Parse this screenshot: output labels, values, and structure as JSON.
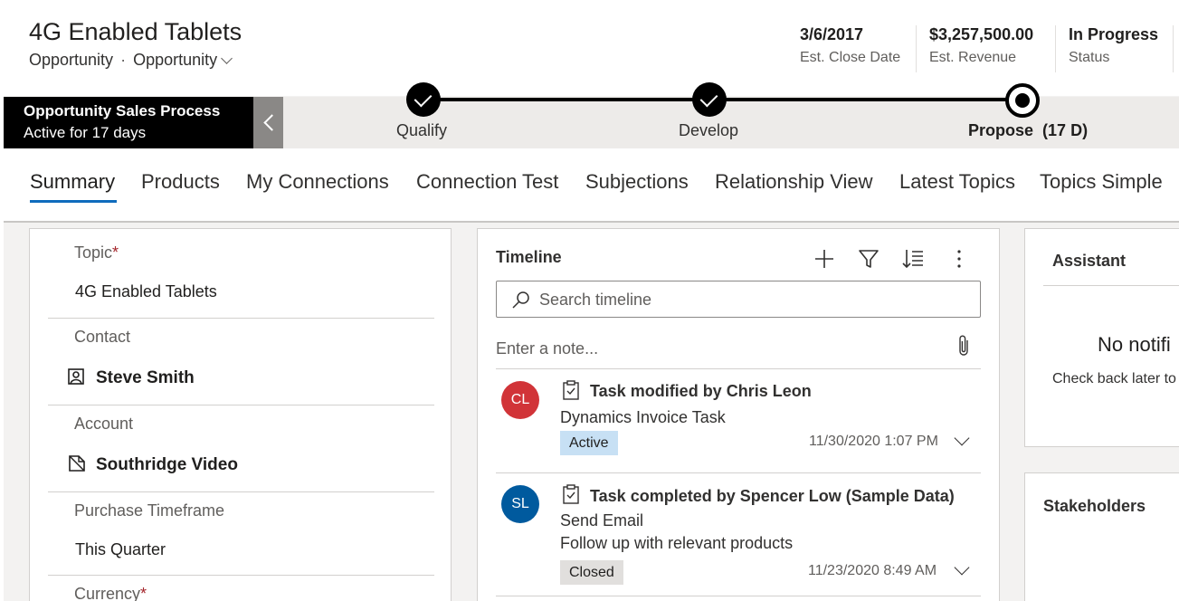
{
  "header": {
    "title": "4G Enabled Tablets",
    "entity": "Opportunity",
    "separator": "·",
    "form": "Opportunity",
    "fields": [
      {
        "value": "3/6/2017",
        "label": "Est. Close Date"
      },
      {
        "value": "$3,257,500.00",
        "label": "Est. Revenue"
      },
      {
        "value": "In Progress",
        "label": "Status"
      }
    ]
  },
  "bpf": {
    "name": "Opportunity Sales Process",
    "duration": "Active for 17 days",
    "stages": [
      {
        "label": "Qualify",
        "state": "completed"
      },
      {
        "label": "Develop",
        "state": "completed"
      },
      {
        "label": "Propose",
        "duration": "(17 D)",
        "state": "active"
      }
    ]
  },
  "tabs": [
    "Summary",
    "Products",
    "My Connections",
    "Connection Test",
    "Subjections",
    "Relationship View",
    "Latest Topics",
    "Topics Simple"
  ],
  "selected_tab": "Summary",
  "form": {
    "fields": [
      {
        "label": "Topic",
        "required": "*",
        "value": "4G Enabled Tablets"
      },
      {
        "label": "Contact",
        "value": "Steve Smith",
        "icon": "contact-icon"
      },
      {
        "label": "Account",
        "value": "Southridge Video",
        "icon": "account-icon"
      },
      {
        "label": "Purchase Timeframe",
        "value": "This Quarter"
      },
      {
        "label": "Currency",
        "required": "*"
      }
    ]
  },
  "timeline": {
    "title": "Timeline",
    "search_placeholder": "Search timeline",
    "note_placeholder": "Enter a note...",
    "activities": [
      {
        "initials": "CL",
        "avatar_color": "#d13438",
        "title": "Task modified by Chris Leon",
        "lines": [
          "Dynamics Invoice Task"
        ],
        "status": "Active",
        "status_color": "#c7e0f4",
        "time": "11/30/2020 1:07 PM"
      },
      {
        "initials": "SL",
        "avatar_color": "#005a9e",
        "title": "Task completed by Spencer Low (Sample Data)",
        "lines": [
          "Send Email",
          "Follow up with relevant products"
        ],
        "status": "Closed",
        "status_color": "#e1dfdd",
        "time": "11/23/2020 8:49 AM"
      }
    ]
  },
  "assistant": {
    "title": "Assistant",
    "empty_title": "No notifi",
    "empty_hint": "Check back later to"
  },
  "stakeholders": {
    "title": "Stakeholders"
  }
}
